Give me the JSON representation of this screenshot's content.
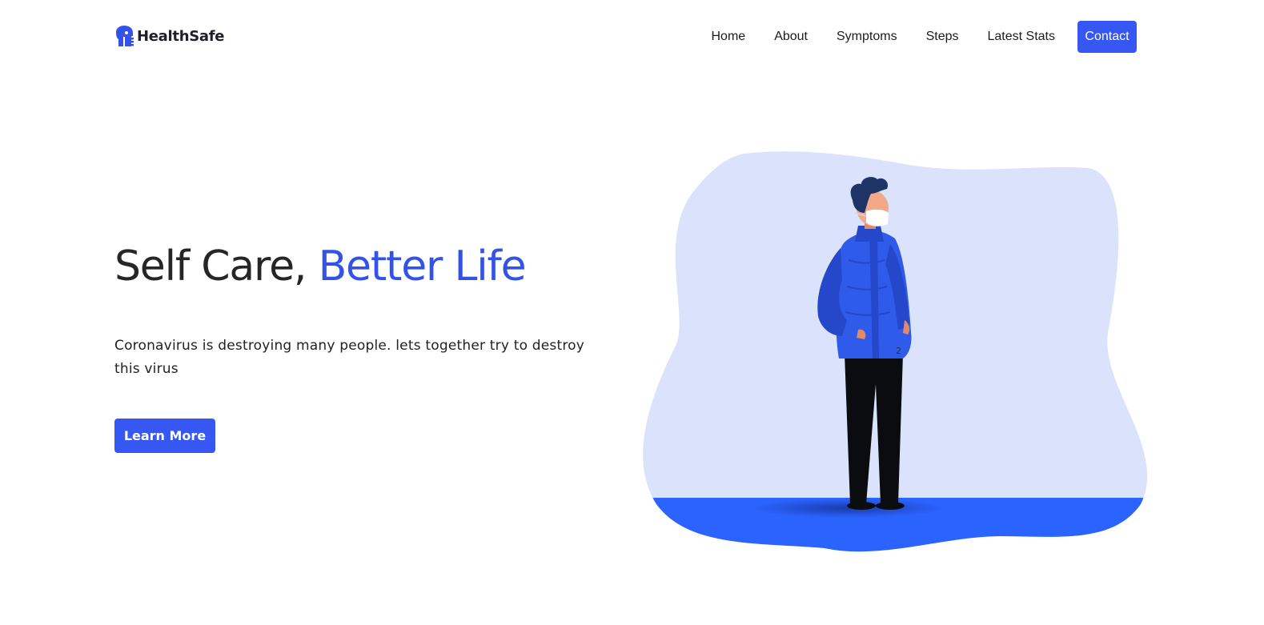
{
  "header": {
    "brand": "HealthSafe",
    "nav": {
      "home": "Home",
      "about": "About",
      "symptoms": "Symptoms",
      "steps": "Steps",
      "latest_stats": "Latest Stats",
      "contact": "Contact"
    }
  },
  "hero": {
    "title_part1": "Self Care,",
    "title_part2": "Better Life",
    "description": "Coronavirus is destroying many people. lets together try to destroy this virus",
    "cta_label": "Learn More",
    "illustration_label": "2"
  },
  "colors": {
    "accent": "#3757f3",
    "blob": "#dbe2fb",
    "ground": "#2b63ff",
    "jacket": "#2f5bea",
    "text_dark": "#262626"
  },
  "icons": {
    "logo": "shield-person-icon"
  }
}
